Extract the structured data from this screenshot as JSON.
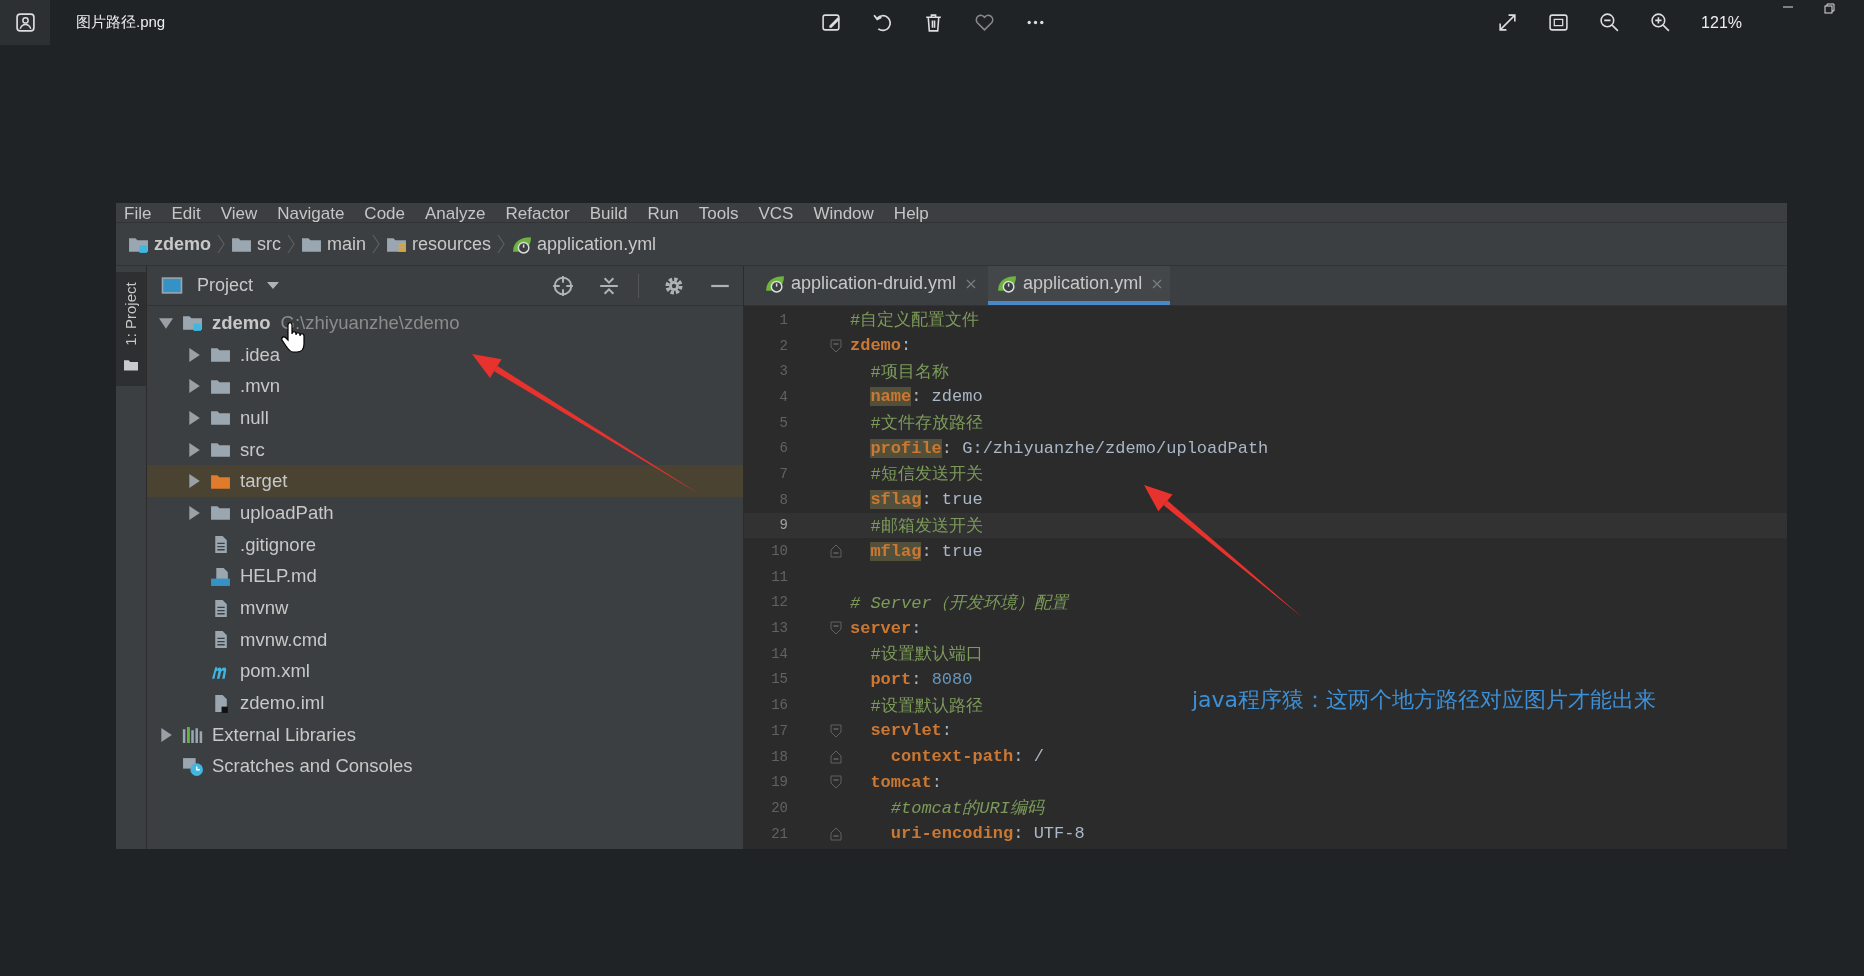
{
  "viewer": {
    "file_name": "图片路径.png",
    "zoom": "121%"
  },
  "ide": {
    "menu": [
      "File",
      "Edit",
      "View",
      "Navigate",
      "Code",
      "Analyze",
      "Refactor",
      "Build",
      "Run",
      "Tools",
      "VCS",
      "Window",
      "Help"
    ],
    "breadcrumbs": [
      {
        "label": "zdemo",
        "kind": "module"
      },
      {
        "label": "src",
        "kind": "folder"
      },
      {
        "label": "main",
        "kind": "folder"
      },
      {
        "label": "resources",
        "kind": "resources"
      },
      {
        "label": "application.yml",
        "kind": "spring"
      }
    ],
    "tool_window": {
      "stripe_label": "1: Project",
      "title": "Project"
    },
    "tree": [
      {
        "label": "zdemo",
        "path": "G:\\zhiyuanzhe\\zdemo",
        "kind": "module",
        "expanded": true,
        "selected": false,
        "children": [
          {
            "label": ".idea",
            "kind": "folder",
            "expanded": false,
            "selected": false
          },
          {
            "label": ".mvn",
            "kind": "folder",
            "expanded": false,
            "selected": false
          },
          {
            "label": "null",
            "kind": "folder",
            "expanded": false,
            "selected": false
          },
          {
            "label": "src",
            "kind": "folder",
            "expanded": false,
            "selected": false
          },
          {
            "label": "target",
            "kind": "folder-excluded",
            "expanded": false,
            "selected": true
          },
          {
            "label": "uploadPath",
            "kind": "folder",
            "expanded": false,
            "selected": false
          },
          {
            "label": ".gitignore",
            "kind": "file",
            "selected": false
          },
          {
            "label": "HELP.md",
            "kind": "markdown",
            "selected": false
          },
          {
            "label": "mvnw",
            "kind": "file",
            "selected": false
          },
          {
            "label": "mvnw.cmd",
            "kind": "file",
            "selected": false
          },
          {
            "label": "pom.xml",
            "kind": "maven",
            "selected": false
          },
          {
            "label": "zdemo.iml",
            "kind": "iml",
            "selected": false
          }
        ]
      },
      {
        "label": "External Libraries",
        "kind": "libraries",
        "expanded": false,
        "selected": false
      },
      {
        "label": "Scratches and Consoles",
        "kind": "scratches",
        "selected": false
      }
    ],
    "tabs": [
      {
        "label": "application-druid.yml",
        "selected": false
      },
      {
        "label": "application.yml",
        "selected": true
      }
    ],
    "editor": {
      "lines": [
        {
          "number": "1",
          "current": false,
          "tokens": [
            {
              "text": "#自定义配置文件",
              "kind": "comment"
            }
          ]
        },
        {
          "number": "2",
          "current": false,
          "fold_open": true,
          "tokens": [
            {
              "text": "zdemo",
              "kind": "key"
            },
            {
              "text": ":",
              "kind": "plain"
            }
          ]
        },
        {
          "number": "3",
          "current": false,
          "tokens": [
            {
              "text": "  #项目名称",
              "kind": "comment"
            }
          ]
        },
        {
          "number": "4",
          "current": false,
          "tokens": [
            {
              "text": "  name",
              "kind": "key-marked"
            },
            {
              "text": ": zdemo",
              "kind": "plain"
            }
          ]
        },
        {
          "number": "5",
          "current": false,
          "tokens": [
            {
              "text": "  #文件存放路径",
              "kind": "comment"
            }
          ]
        },
        {
          "number": "6",
          "current": false,
          "tokens": [
            {
              "text": "  profile",
              "kind": "key-marked"
            },
            {
              "text": ": G:/zhiyuanzhe/zdemo/uploadPath",
              "kind": "plain"
            }
          ]
        },
        {
          "number": "7",
          "current": false,
          "tokens": [
            {
              "text": "  #短信发送开关",
              "kind": "comment"
            }
          ]
        },
        {
          "number": "8",
          "current": false,
          "tokens": [
            {
              "text": "  sflag",
              "kind": "key-marked"
            },
            {
              "text": ": true",
              "kind": "plain"
            }
          ]
        },
        {
          "number": "9",
          "current": true,
          "tokens": [
            {
              "text": "  #邮箱发送开关",
              "kind": "comment"
            }
          ]
        },
        {
          "number": "10",
          "current": false,
          "fold_close": true,
          "tokens": [
            {
              "text": "  mflag",
              "kind": "key-marked"
            },
            {
              "text": ": true",
              "kind": "plain"
            }
          ]
        },
        {
          "number": "11",
          "current": false
        },
        {
          "number": "12",
          "current": false,
          "tokens": [
            {
              "text": "# Server（开发环境）配置",
              "kind": "comment-italic"
            }
          ]
        },
        {
          "number": "13",
          "current": false,
          "fold_open": true,
          "tokens": [
            {
              "text": "server",
              "kind": "key"
            },
            {
              "text": ":",
              "kind": "plain"
            }
          ]
        },
        {
          "number": "14",
          "current": false,
          "tokens": [
            {
              "text": "  #设置默认端口",
              "kind": "comment"
            }
          ]
        },
        {
          "number": "15",
          "current": false,
          "tokens": [
            {
              "text": "  port",
              "kind": "key"
            },
            {
              "text": ": ",
              "kind": "plain"
            },
            {
              "text": "8080",
              "kind": "number"
            }
          ]
        },
        {
          "number": "16",
          "current": false,
          "tokens": [
            {
              "text": "  #设置默认路径",
              "kind": "comment"
            }
          ]
        },
        {
          "number": "17",
          "current": false,
          "fold_open": true,
          "tokens": [
            {
              "text": "  servlet",
              "kind": "key"
            },
            {
              "text": ":",
              "kind": "plain"
            }
          ]
        },
        {
          "number": "18",
          "current": false,
          "fold_close": true,
          "tokens": [
            {
              "text": "    context-path",
              "kind": "key"
            },
            {
              "text": ": /",
              "kind": "plain"
            }
          ]
        },
        {
          "number": "19",
          "current": false,
          "fold_open": true,
          "tokens": [
            {
              "text": "  tomcat",
              "kind": "key"
            },
            {
              "text": ":",
              "kind": "plain"
            }
          ]
        },
        {
          "number": "20",
          "current": false,
          "tokens": [
            {
              "text": "    #tomcat的URI编码",
              "kind": "comment-italic"
            }
          ]
        },
        {
          "number": "21",
          "current": false,
          "fold_close": true,
          "tokens": [
            {
              "text": "    uri-encoding",
              "kind": "key"
            },
            {
              "text": ": UTF-8",
              "kind": "plain"
            }
          ]
        }
      ]
    }
  },
  "annotation": {
    "text": "java程序猿：这两个地方路径对应图片才能出来"
  }
}
